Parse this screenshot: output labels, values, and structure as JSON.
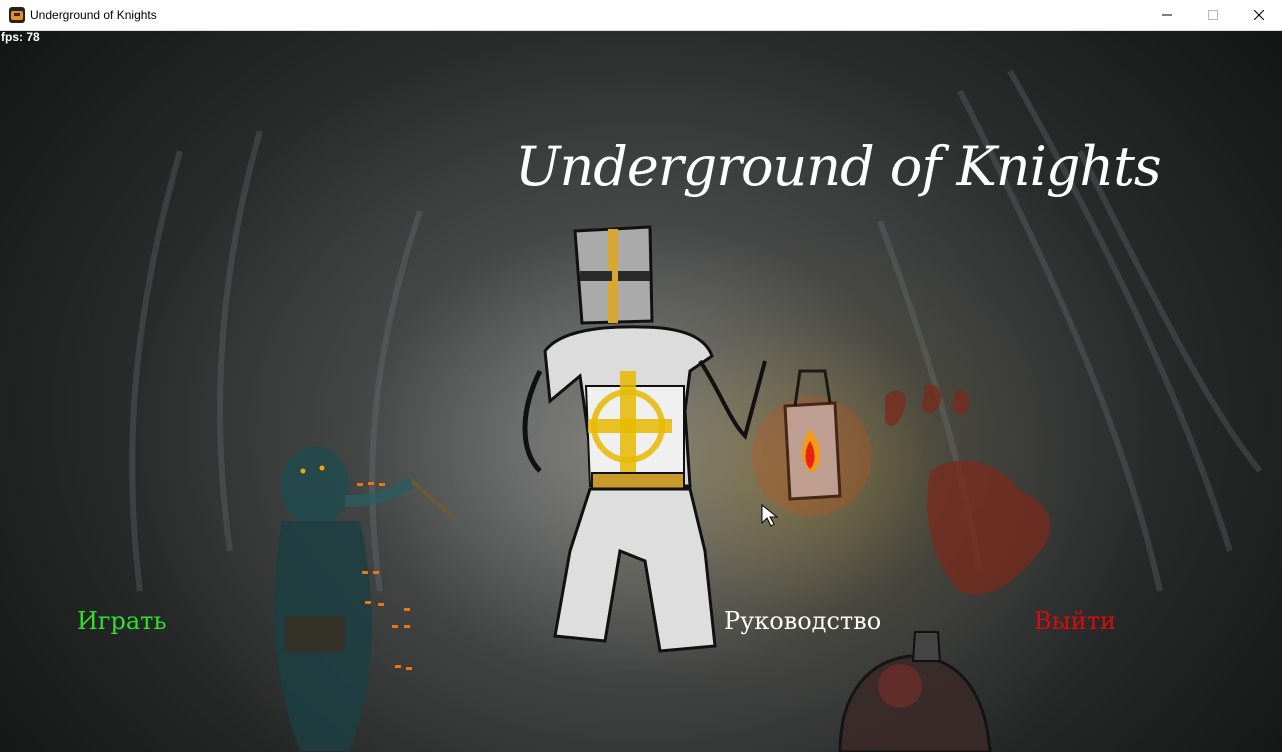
{
  "window": {
    "title": "Underground of Knights",
    "icon": "game-icon",
    "controls": [
      "minimize-icon",
      "maximize-icon",
      "close-icon"
    ]
  },
  "hud": {
    "fps": "fps: 78"
  },
  "game": {
    "title": "Underground of Knights"
  },
  "menu": {
    "play": "Играть",
    "guide": "Руководство",
    "exit": "Выйти"
  },
  "colors": {
    "play": "#2fe02a",
    "guide": "#ffffff",
    "exit": "#d60d0d"
  }
}
